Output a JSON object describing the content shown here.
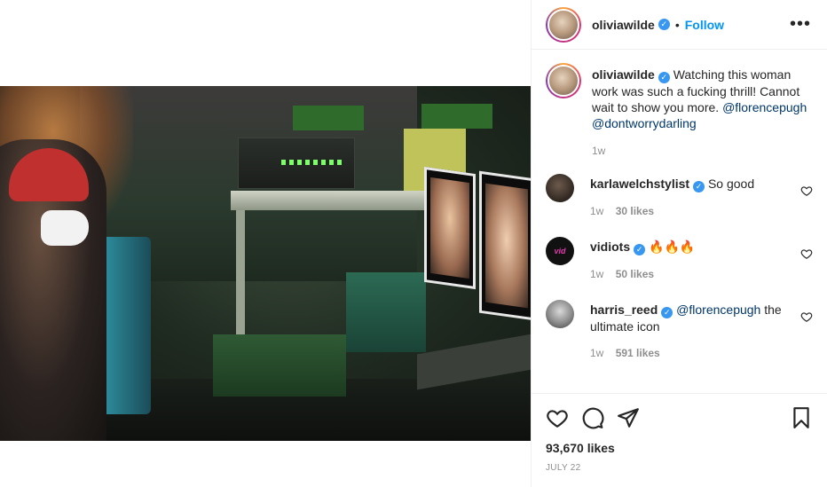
{
  "post": {
    "author": "oliviawilde",
    "verified": true,
    "follow_label": "Follow",
    "separator": "•",
    "more_label": "•••",
    "caption_text": "Watching this woman work was such a fucking thrill! Cannot wait to show you more.",
    "caption_mentions": [
      "@florencepugh",
      "@dontworrydarling"
    ],
    "caption_time": "1w"
  },
  "comments": [
    {
      "user": "karlawelchstylist",
      "verified": true,
      "text": "So good",
      "time": "1w",
      "likes": "30 likes",
      "avatar_color": "#3a2e26"
    },
    {
      "user": "vidiots",
      "verified": true,
      "text": "🔥🔥🔥",
      "time": "1w",
      "likes": "50 likes",
      "avatar_color": "#111111"
    },
    {
      "user": "harris_reed",
      "verified": true,
      "mention": "@florencepugh",
      "text": "the ultimate icon",
      "time": "1w",
      "likes": "591 likes",
      "avatar_color": "#5a5a5a"
    }
  ],
  "footer": {
    "likes": "93,670 likes",
    "date": "JULY 22"
  },
  "icons": [
    "heart-icon",
    "comment-icon",
    "share-icon",
    "bookmark-icon",
    "more-icon",
    "verified-icon"
  ],
  "colors": {
    "accent": "#0095f6",
    "mention": "#00376b",
    "muted": "#8e8e8e",
    "verified": "#3897f0"
  }
}
